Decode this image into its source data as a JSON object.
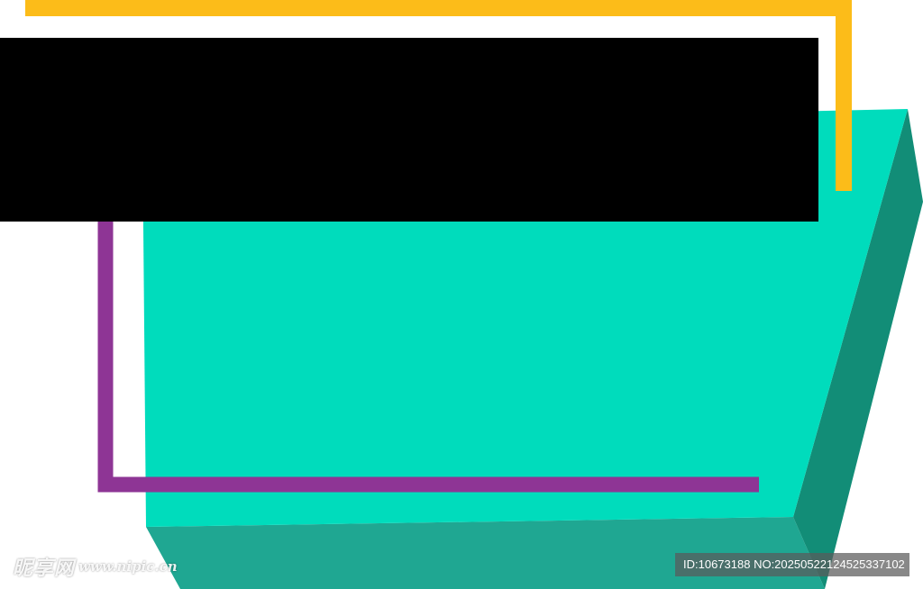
{
  "colors": {
    "background": "#ffffff",
    "face": "#00dcbc",
    "side_right": "#128d77",
    "side_bottom": "#1fa792",
    "yellow_line": "#fcbc19",
    "purple_line": "#8e3595",
    "black_bar": "#000000"
  },
  "watermark": {
    "logo_text": "昵享网",
    "site_text": "www.nipic.cn",
    "id_text": "ID:10673188 NO:20250522124525337102"
  }
}
